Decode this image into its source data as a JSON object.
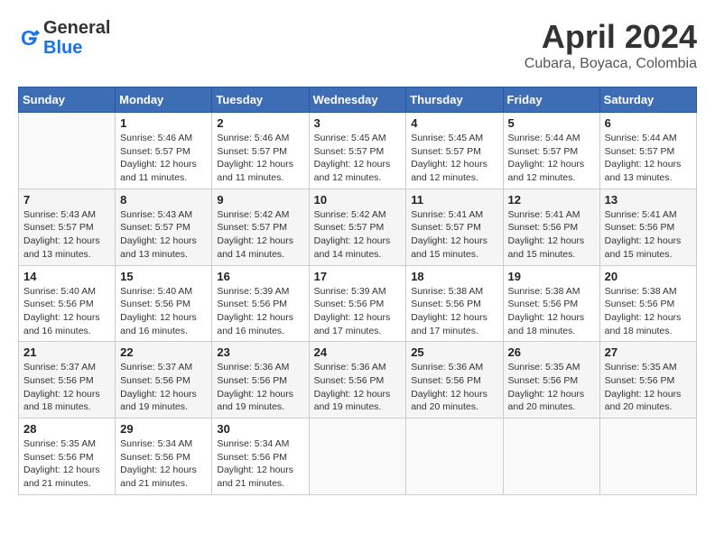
{
  "logo": {
    "line1": "General",
    "line2": "Blue"
  },
  "title": "April 2024",
  "subtitle": "Cubara, Boyaca, Colombia",
  "headers": [
    "Sunday",
    "Monday",
    "Tuesday",
    "Wednesday",
    "Thursday",
    "Friday",
    "Saturday"
  ],
  "weeks": [
    [
      {
        "day": "",
        "info": ""
      },
      {
        "day": "1",
        "info": "Sunrise: 5:46 AM\nSunset: 5:57 PM\nDaylight: 12 hours\nand 11 minutes."
      },
      {
        "day": "2",
        "info": "Sunrise: 5:46 AM\nSunset: 5:57 PM\nDaylight: 12 hours\nand 11 minutes."
      },
      {
        "day": "3",
        "info": "Sunrise: 5:45 AM\nSunset: 5:57 PM\nDaylight: 12 hours\nand 12 minutes."
      },
      {
        "day": "4",
        "info": "Sunrise: 5:45 AM\nSunset: 5:57 PM\nDaylight: 12 hours\nand 12 minutes."
      },
      {
        "day": "5",
        "info": "Sunrise: 5:44 AM\nSunset: 5:57 PM\nDaylight: 12 hours\nand 12 minutes."
      },
      {
        "day": "6",
        "info": "Sunrise: 5:44 AM\nSunset: 5:57 PM\nDaylight: 12 hours\nand 13 minutes."
      }
    ],
    [
      {
        "day": "7",
        "info": "Sunrise: 5:43 AM\nSunset: 5:57 PM\nDaylight: 12 hours\nand 13 minutes."
      },
      {
        "day": "8",
        "info": "Sunrise: 5:43 AM\nSunset: 5:57 PM\nDaylight: 12 hours\nand 13 minutes."
      },
      {
        "day": "9",
        "info": "Sunrise: 5:42 AM\nSunset: 5:57 PM\nDaylight: 12 hours\nand 14 minutes."
      },
      {
        "day": "10",
        "info": "Sunrise: 5:42 AM\nSunset: 5:57 PM\nDaylight: 12 hours\nand 14 minutes."
      },
      {
        "day": "11",
        "info": "Sunrise: 5:41 AM\nSunset: 5:57 PM\nDaylight: 12 hours\nand 15 minutes."
      },
      {
        "day": "12",
        "info": "Sunrise: 5:41 AM\nSunset: 5:56 PM\nDaylight: 12 hours\nand 15 minutes."
      },
      {
        "day": "13",
        "info": "Sunrise: 5:41 AM\nSunset: 5:56 PM\nDaylight: 12 hours\nand 15 minutes."
      }
    ],
    [
      {
        "day": "14",
        "info": "Sunrise: 5:40 AM\nSunset: 5:56 PM\nDaylight: 12 hours\nand 16 minutes."
      },
      {
        "day": "15",
        "info": "Sunrise: 5:40 AM\nSunset: 5:56 PM\nDaylight: 12 hours\nand 16 minutes."
      },
      {
        "day": "16",
        "info": "Sunrise: 5:39 AM\nSunset: 5:56 PM\nDaylight: 12 hours\nand 16 minutes."
      },
      {
        "day": "17",
        "info": "Sunrise: 5:39 AM\nSunset: 5:56 PM\nDaylight: 12 hours\nand 17 minutes."
      },
      {
        "day": "18",
        "info": "Sunrise: 5:38 AM\nSunset: 5:56 PM\nDaylight: 12 hours\nand 17 minutes."
      },
      {
        "day": "19",
        "info": "Sunrise: 5:38 AM\nSunset: 5:56 PM\nDaylight: 12 hours\nand 18 minutes."
      },
      {
        "day": "20",
        "info": "Sunrise: 5:38 AM\nSunset: 5:56 PM\nDaylight: 12 hours\nand 18 minutes."
      }
    ],
    [
      {
        "day": "21",
        "info": "Sunrise: 5:37 AM\nSunset: 5:56 PM\nDaylight: 12 hours\nand 18 minutes."
      },
      {
        "day": "22",
        "info": "Sunrise: 5:37 AM\nSunset: 5:56 PM\nDaylight: 12 hours\nand 19 minutes."
      },
      {
        "day": "23",
        "info": "Sunrise: 5:36 AM\nSunset: 5:56 PM\nDaylight: 12 hours\nand 19 minutes."
      },
      {
        "day": "24",
        "info": "Sunrise: 5:36 AM\nSunset: 5:56 PM\nDaylight: 12 hours\nand 19 minutes."
      },
      {
        "day": "25",
        "info": "Sunrise: 5:36 AM\nSunset: 5:56 PM\nDaylight: 12 hours\nand 20 minutes."
      },
      {
        "day": "26",
        "info": "Sunrise: 5:35 AM\nSunset: 5:56 PM\nDaylight: 12 hours\nand 20 minutes."
      },
      {
        "day": "27",
        "info": "Sunrise: 5:35 AM\nSunset: 5:56 PM\nDaylight: 12 hours\nand 20 minutes."
      }
    ],
    [
      {
        "day": "28",
        "info": "Sunrise: 5:35 AM\nSunset: 5:56 PM\nDaylight: 12 hours\nand 21 minutes."
      },
      {
        "day": "29",
        "info": "Sunrise: 5:34 AM\nSunset: 5:56 PM\nDaylight: 12 hours\nand 21 minutes."
      },
      {
        "day": "30",
        "info": "Sunrise: 5:34 AM\nSunset: 5:56 PM\nDaylight: 12 hours\nand 21 minutes."
      },
      {
        "day": "",
        "info": ""
      },
      {
        "day": "",
        "info": ""
      },
      {
        "day": "",
        "info": ""
      },
      {
        "day": "",
        "info": ""
      }
    ]
  ]
}
